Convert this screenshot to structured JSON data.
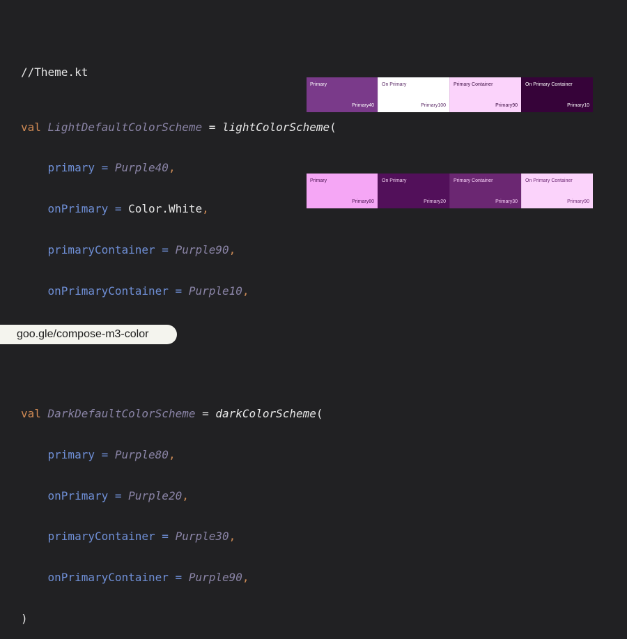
{
  "code": {
    "comment": "//Theme.kt",
    "light": {
      "keyword": "val",
      "name": "LightDefaultColorScheme",
      "eq": "=",
      "fn": "lightColorScheme",
      "open": "(",
      "assignments": [
        {
          "prop": "primary",
          "eq": " = ",
          "value": "Purple40",
          "comma": ","
        },
        {
          "prop": "onPrimary",
          "eq": " = ",
          "value_plain": "Color.White",
          "comma": ","
        },
        {
          "prop": "primaryContainer",
          "eq": " = ",
          "value": "Purple90",
          "comma": ","
        },
        {
          "prop": "onPrimaryContainer",
          "eq": " = ",
          "value": "Purple10",
          "comma": ","
        }
      ],
      "close": ")"
    },
    "dark": {
      "keyword": "val",
      "name": "DarkDefaultColorScheme",
      "eq": "=",
      "fn": "darkColorScheme",
      "open": "(",
      "assignments": [
        {
          "prop": "primary",
          "eq": " = ",
          "value": "Purple80",
          "comma": ","
        },
        {
          "prop": "onPrimary",
          "eq": " = ",
          "value": "Purple20",
          "comma": ","
        },
        {
          "prop": "primaryContainer",
          "eq": " = ",
          "value": "Purple30",
          "comma": ","
        },
        {
          "prop": "onPrimaryContainer",
          "eq": " = ",
          "value": "Purple90",
          "comma": ","
        }
      ],
      "close": ")"
    }
  },
  "light_swatches": [
    {
      "name": "Primary",
      "tone": "Primary40",
      "bg": "#7a3a8a",
      "fg": "#ffffff"
    },
    {
      "name": "On Primary",
      "tone": "Primary100",
      "bg": "#ffffff",
      "fg": "#5a2a66"
    },
    {
      "name": "Primary Container",
      "tone": "Primary90",
      "bg": "#fbd3fb",
      "fg": "#3a0b40"
    },
    {
      "name": "On Primary Container",
      "tone": "Primary10",
      "bg": "#360339",
      "fg": "#ffffff"
    }
  ],
  "dark_swatches": [
    {
      "name": "Primary",
      "tone": "Primary80",
      "bg": "#f5a6f5",
      "fg": "#4a1150"
    },
    {
      "name": "On Primary",
      "tone": "Primary20",
      "bg": "#52105a",
      "fg": "#f2d2f2"
    },
    {
      "name": "Primary Container",
      "tone": "Primary30",
      "bg": "#6b2772",
      "fg": "#fbd3fb"
    },
    {
      "name": "On Primary Container",
      "tone": "Primary90",
      "bg": "#fbd3fb",
      "fg": "#6b2772"
    }
  ],
  "link": {
    "text": "goo.gle/compose-m3-color"
  }
}
